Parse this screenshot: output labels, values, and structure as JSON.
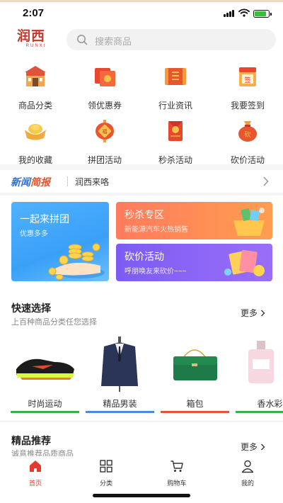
{
  "status_bar": {
    "time": "2:07"
  },
  "header": {
    "logo_text": "润西",
    "logo_subtext": "RUNXI",
    "search_placeholder": "搜索商品"
  },
  "categories": [
    {
      "label": "商品分类",
      "icon": "shop-icon"
    },
    {
      "label": "领优惠券",
      "icon": "coupon-icon"
    },
    {
      "label": "行业资讯",
      "icon": "scroll-icon"
    },
    {
      "label": "我要签到",
      "icon": "calendar-sign-icon"
    },
    {
      "label": "我的收藏",
      "icon": "gold-ingot-icon"
    },
    {
      "label": "拼团活动",
      "icon": "lantern-icon"
    },
    {
      "label": "秒杀活动",
      "icon": "red-envelope-icon"
    },
    {
      "label": "砍价活动",
      "icon": "money-bag-icon"
    }
  ],
  "news": {
    "brand_part1": "新闻",
    "brand_part2": "简报",
    "text": "润西来咯"
  },
  "promos": {
    "group": {
      "title": "一起来拼团",
      "subtitle": "优惠多多"
    },
    "flash": {
      "title": "秒杀专区",
      "subtitle": "新能源汽车火热销售"
    },
    "bargain": {
      "title": "砍价活动",
      "subtitle": "呼朋唤友来砍价~~~"
    }
  },
  "quick_select": {
    "title": "快速选择",
    "subtitle": "上百种商品分类任您选择",
    "more": "更多",
    "items": [
      {
        "name": "时尚运动",
        "color": "#3cae4e"
      },
      {
        "name": "精品男装",
        "color": "#4a8be0"
      },
      {
        "name": "箱包",
        "color": "#e2533b"
      },
      {
        "name": "香水彩",
        "color": "#3cae4e"
      }
    ]
  },
  "recommend": {
    "title": "精品推荐",
    "subtitle": "诚意推荐品质商品",
    "more": "更多"
  },
  "tabbar": [
    {
      "label": "首页",
      "icon": "home-icon",
      "active": true
    },
    {
      "label": "分类",
      "icon": "grid-icon",
      "active": false
    },
    {
      "label": "购物车",
      "icon": "cart-icon",
      "active": false
    },
    {
      "label": "我的",
      "icon": "user-icon",
      "active": false
    }
  ],
  "colors": {
    "accent": "#e23b2e",
    "brand_red": "#c0392b"
  }
}
